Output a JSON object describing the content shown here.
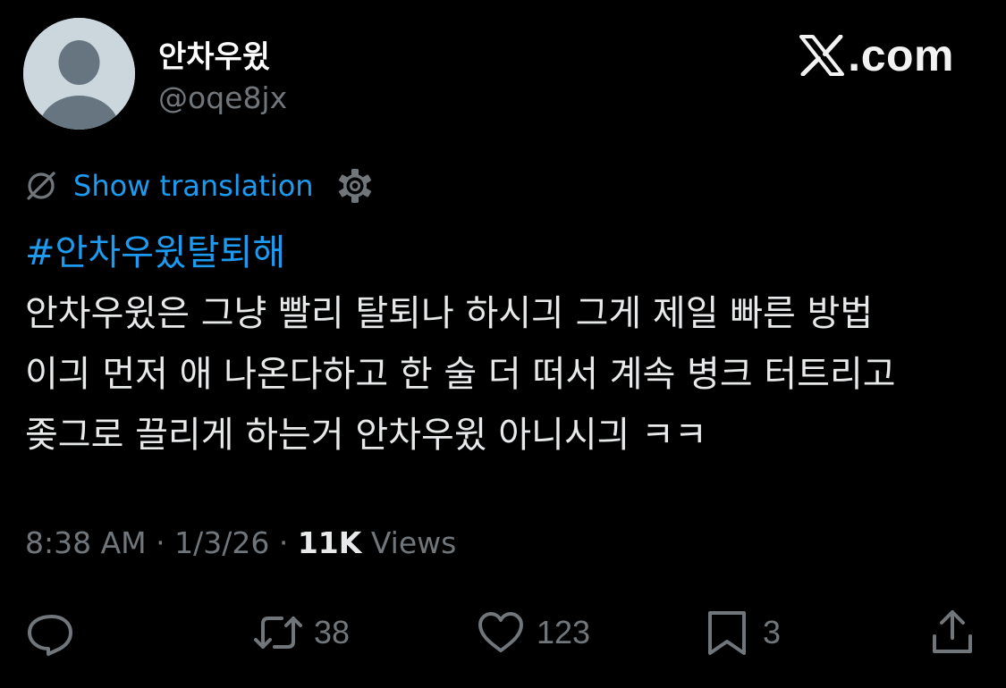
{
  "author": {
    "display_name": "안차우윘",
    "handle": "@oqe8jx"
  },
  "brand": {
    "text": ".com"
  },
  "translation": {
    "label": "Show translation"
  },
  "tweet": {
    "hashtag": "#안차우윘탈퇴해",
    "lines": [
      "안차우윘은 그냥 빨리 탈퇴나 하시긔 그게 제일 빠른 방법",
      "이긔 먼저 애 나온다하고 한 술 더 떠서 계속 병크 터트리고",
      "좆그로 끌리게 하는거 안차우윘 아니시긔  ㅋㅋ"
    ]
  },
  "meta": {
    "time": "8:38 AM",
    "sep1": " · ",
    "date": "1/3/26",
    "sep2": " · ",
    "views_count": "11K",
    "views_label": " Views"
  },
  "actions": {
    "reply_icon": "reply-icon",
    "retweet_count": "38",
    "like_count": "123",
    "bookmark_count": "3",
    "share_icon": "share-icon"
  },
  "colors": {
    "background": "#000000",
    "link": "#1d9bf0",
    "muted": "#71767b",
    "text": "#e7e9ea"
  }
}
